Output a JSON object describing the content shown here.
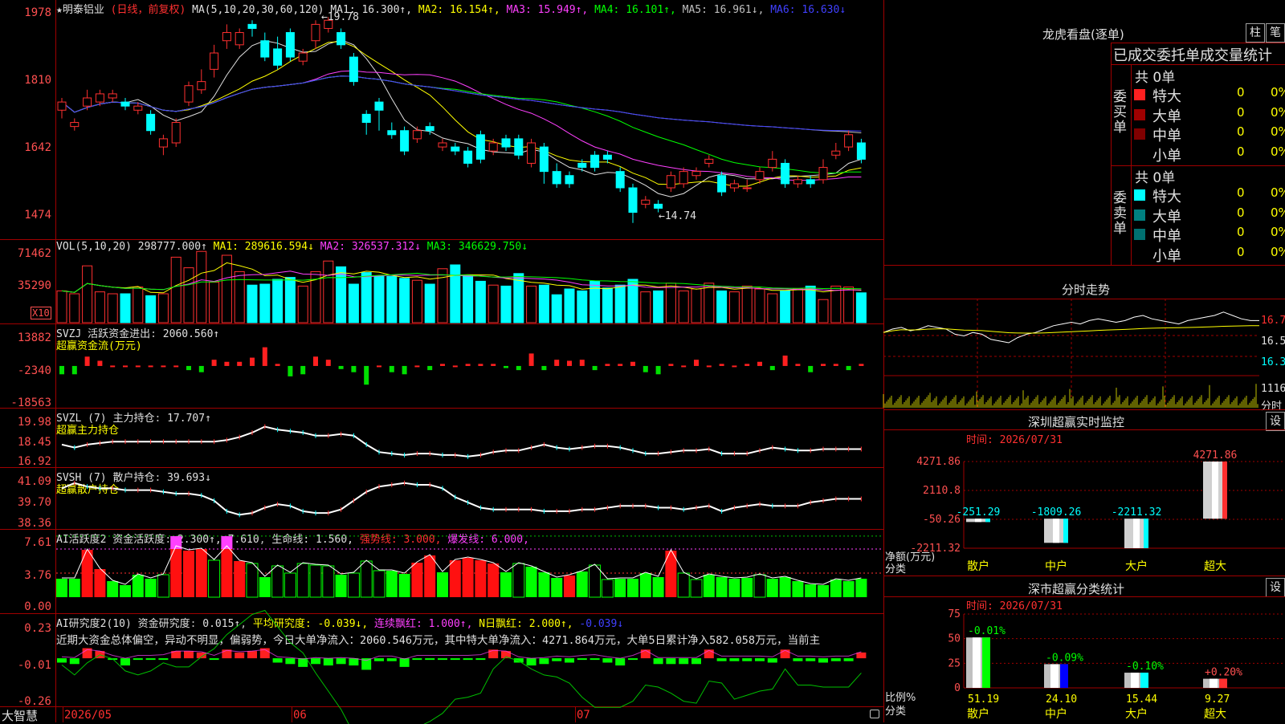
{
  "main_chart": {
    "title": "★明泰铝业",
    "subtitle": "(日线，前复权)",
    "ma_label": "MA(5,10,20,30,60,120)",
    "ma_values": [
      {
        "text": "MA1: 16.300↑,",
        "color": "#e0e0e0"
      },
      {
        "text": "MA2: 16.154↑,",
        "color": "#ffff00"
      },
      {
        "text": "MA3: 15.949↑,",
        "color": "#ff40ff"
      },
      {
        "text": "MA4: 16.101↑,",
        "color": "#00ff00"
      },
      {
        "text": "MA5: 16.961↓,",
        "color": "#c0c0c0"
      },
      {
        "text": "MA6: 16.630↓",
        "color": "#4040ff"
      }
    ],
    "y_ticks": [
      "1978",
      "1810",
      "1642",
      "1474"
    ],
    "high_mark": "19.78",
    "low_mark": "14.74",
    "x_labels": [
      "2026/05",
      "06",
      "07"
    ]
  },
  "chart_data": [
    {
      "type": "candlestick",
      "name": "K线",
      "y_range": [
        14.5,
        20.0
      ],
      "candles": [
        [
          17.5,
          17.7,
          17.3,
          17.8
        ],
        [
          17.1,
          17.2,
          17.0,
          17.3
        ],
        [
          17.6,
          17.8,
          17.5,
          18.0
        ],
        [
          17.7,
          17.9,
          17.6,
          18.0
        ],
        [
          17.8,
          17.9,
          17.7,
          18.0
        ],
        [
          17.7,
          17.6,
          17.5,
          17.8
        ],
        [
          17.5,
          17.6,
          17.4,
          17.7
        ],
        [
          17.4,
          17.0,
          16.9,
          17.5
        ],
        [
          16.6,
          16.8,
          16.4,
          16.9
        ],
        [
          16.7,
          17.2,
          16.6,
          17.3
        ],
        [
          17.7,
          18.1,
          17.6,
          18.2
        ],
        [
          18.0,
          18.2,
          17.9,
          18.5
        ],
        [
          18.5,
          18.9,
          18.3,
          19.1
        ],
        [
          19.2,
          19.4,
          19.0,
          19.6
        ],
        [
          19.1,
          19.4,
          19.0,
          19.5
        ],
        [
          19.6,
          19.5,
          19.3,
          19.7
        ],
        [
          19.2,
          18.8,
          18.7,
          19.4
        ],
        [
          19.0,
          18.6,
          18.5,
          19.3
        ],
        [
          19.4,
          18.8,
          18.7,
          19.5
        ],
        [
          18.7,
          18.9,
          18.6,
          19.0
        ],
        [
          19.2,
          19.6,
          19.0,
          19.7
        ],
        [
          19.5,
          19.7,
          19.4,
          19.78
        ],
        [
          19.4,
          19.1,
          19.0,
          19.5
        ],
        [
          18.8,
          18.2,
          18.1,
          18.9
        ],
        [
          17.4,
          17.2,
          16.9,
          17.5
        ],
        [
          17.7,
          17.5,
          17.0,
          17.8
        ],
        [
          17.0,
          16.9,
          16.8,
          17.2
        ],
        [
          17.0,
          16.5,
          16.4,
          17.1
        ],
        [
          16.8,
          17.0,
          16.7,
          17.1
        ],
        [
          17.1,
          17.0,
          16.9,
          17.2
        ],
        [
          16.6,
          16.7,
          16.5,
          16.8
        ],
        [
          16.6,
          16.5,
          16.4,
          16.7
        ],
        [
          16.5,
          16.2,
          16.1,
          16.6
        ],
        [
          16.9,
          16.3,
          16.2,
          17.0
        ],
        [
          16.5,
          16.7,
          16.4,
          16.8
        ],
        [
          16.8,
          16.6,
          16.5,
          16.9
        ],
        [
          16.8,
          16.4,
          16.3,
          16.9
        ],
        [
          16.2,
          16.7,
          16.1,
          16.8
        ],
        [
          16.6,
          16.0,
          15.7,
          16.7
        ],
        [
          16.0,
          15.7,
          15.6,
          16.2
        ],
        [
          15.9,
          15.7,
          15.6,
          16.0
        ],
        [
          16.2,
          16.1,
          16.0,
          16.3
        ],
        [
          16.4,
          16.1,
          16.0,
          16.5
        ],
        [
          16.4,
          16.3,
          16.2,
          16.5
        ],
        [
          16.0,
          15.6,
          15.5,
          16.1
        ],
        [
          15.6,
          15.0,
          14.74,
          15.7
        ],
        [
          15.2,
          15.3,
          15.1,
          15.4
        ],
        [
          15.2,
          15.1,
          15.0,
          15.3
        ],
        [
          15.6,
          15.9,
          15.5,
          16.0
        ],
        [
          15.7,
          16.0,
          15.6,
          16.1
        ],
        [
          15.9,
          16.0,
          15.8,
          16.1
        ],
        [
          16.2,
          16.3,
          16.1,
          16.4
        ],
        [
          15.9,
          15.5,
          15.4,
          16.0
        ],
        [
          15.6,
          15.7,
          15.5,
          15.8
        ],
        [
          15.6,
          15.6,
          15.5,
          15.8
        ],
        [
          15.8,
          16.0,
          15.7,
          16.1
        ],
        [
          16.1,
          16.3,
          16.0,
          16.5
        ],
        [
          16.2,
          15.7,
          15.6,
          16.3
        ],
        [
          15.7,
          15.8,
          15.6,
          15.9
        ],
        [
          15.8,
          15.7,
          15.6,
          15.9
        ],
        [
          15.8,
          16.1,
          15.7,
          16.3
        ],
        [
          16.4,
          16.5,
          16.3,
          16.7
        ],
        [
          16.6,
          16.9,
          16.5,
          17.0
        ],
        [
          16.7,
          16.3,
          16.2,
          16.8
        ]
      ],
      "legend": [
        "MA1",
        "MA2",
        "MA3",
        "MA4",
        "MA5",
        "MA6"
      ]
    },
    {
      "type": "bar",
      "name": "VOL(5,10,20)",
      "y_range": [
        0,
        80000
      ],
      "header": "298777.000↑",
      "ma": [
        "MA1: 289616.594↓",
        "MA2: 326537.312↓",
        "MA3: 346629.750↓"
      ],
      "y_ticks": [
        "71462",
        "35290"
      ],
      "unit": "X10",
      "values": [
        33000,
        30000,
        59000,
        32000,
        30000,
        30000,
        37000,
        28000,
        30000,
        68000,
        57000,
        74000,
        42000,
        70000,
        53000,
        39000,
        40000,
        45000,
        47000,
        38000,
        53000,
        64000,
        58000,
        40000,
        52000,
        48000,
        48000,
        46000,
        44000,
        40000,
        56000,
        60000,
        49000,
        43000,
        39000,
        38000,
        51000,
        38000,
        39000,
        29000,
        35000,
        33000,
        43000,
        36000,
        39000,
        45000,
        32000,
        33000,
        41000,
        33000,
        35000,
        41000,
        33000,
        32000,
        38000,
        35000,
        30000,
        33000,
        35000,
        38000,
        24000,
        38000,
        37000,
        31000
      ]
    },
    {
      "type": "bar",
      "name": "SVZJ 活跃资金进出",
      "subtitle": "超赢资金流(万元)",
      "value": "2060.560↑",
      "y_ticks": [
        "13882",
        "-2340",
        "-18563"
      ],
      "y_range": [
        -18563,
        13882
      ],
      "values": [
        -4000,
        -4000,
        4500,
        2500,
        200,
        200,
        200,
        200,
        200,
        200,
        -2000,
        -3000,
        3000,
        2000,
        2000,
        4000,
        9000,
        1000,
        -5000,
        -4000,
        4500,
        3000,
        -1500,
        -3000,
        -9000,
        200,
        -3000,
        -4000,
        200,
        -2000,
        1000,
        200,
        1000,
        1000,
        1000,
        -1000,
        -2000,
        6000,
        -2000,
        3000,
        2500,
        3000,
        -2000,
        1000,
        1000,
        2000,
        -3000,
        -4000,
        1000,
        200,
        3000,
        200,
        1000,
        200,
        1000,
        2000,
        -2000,
        5000,
        1000,
        -3000,
        1000,
        1000,
        -2000,
        1000
      ]
    },
    {
      "type": "line",
      "name": "SVZL (7) 主力持仓",
      "subtitle": "超赢主力持仓",
      "value": "17.707↑",
      "y_ticks": [
        "19.98",
        "18.45",
        "16.92"
      ],
      "y_range": [
        16.92,
        19.98
      ],
      "values": [
        18.0,
        17.8,
        18.0,
        18.1,
        18.2,
        18.2,
        18.2,
        18.2,
        18.2,
        18.2,
        18.2,
        18.2,
        18.2,
        18.3,
        18.5,
        18.8,
        19.2,
        19.0,
        18.9,
        18.8,
        18.6,
        18.6,
        18.7,
        18.6,
        18.0,
        17.5,
        17.4,
        17.3,
        17.4,
        17.4,
        17.3,
        17.3,
        17.2,
        17.3,
        17.5,
        17.6,
        17.6,
        17.8,
        18.0,
        17.8,
        17.7,
        17.8,
        17.9,
        17.9,
        17.8,
        17.6,
        17.4,
        17.4,
        17.5,
        17.6,
        17.6,
        17.7,
        17.4,
        17.4,
        17.4,
        17.6,
        17.8,
        17.7,
        17.6,
        17.6,
        17.7,
        17.7,
        17.7,
        17.7
      ]
    },
    {
      "type": "line",
      "name": "SVSH (7) 散户持仓",
      "subtitle": "超赢散户持仓",
      "value": "39.693↓",
      "y_ticks": [
        "41.09",
        "39.70",
        "38.36"
      ],
      "y_range": [
        38.36,
        41.09
      ],
      "values": [
        40.3,
        40.6,
        40.4,
        40.3,
        40.3,
        40.2,
        40.2,
        40.2,
        40.1,
        40.0,
        40.0,
        39.9,
        39.6,
        39.0,
        38.8,
        38.9,
        39.2,
        39.4,
        39.3,
        39.0,
        38.9,
        38.9,
        39.1,
        39.6,
        40.1,
        40.4,
        40.5,
        40.6,
        40.5,
        40.5,
        40.3,
        39.8,
        39.5,
        39.2,
        39.1,
        39.1,
        39.1,
        39.1,
        39.0,
        39.0,
        39.0,
        39.1,
        39.1,
        39.2,
        39.3,
        39.3,
        39.3,
        39.2,
        39.2,
        39.1,
        39.2,
        39.3,
        39.0,
        39.2,
        39.3,
        39.4,
        39.3,
        39.3,
        39.3,
        39.5,
        39.6,
        39.7,
        39.7,
        39.7
      ]
    },
    {
      "type": "bar",
      "name": "AI活跃度2 资金活跃度",
      "value": "2.300↑, 7.610",
      "extras": [
        {
          "text": "生命线: 1.560,",
          "color": "#e0e0e0"
        },
        {
          "text": "强势线: 3.000,",
          "color": "#ff3030"
        },
        {
          "text": "爆发线: 6.000,",
          "color": "#ff40ff"
        }
      ],
      "y_ticks": [
        "7.61",
        "3.76",
        "0.00"
      ],
      "y_range": [
        0,
        8
      ],
      "values": [
        2.3,
        2.3,
        5.9,
        3.5,
        2.0,
        1.5,
        2.8,
        2.3,
        2.8,
        6.3,
        5.8,
        6.0,
        4.6,
        6.3,
        4.5,
        4.2,
        2.5,
        3.9,
        3.0,
        4.2,
        4.0,
        3.9,
        2.8,
        3.0,
        4.5,
        3.3,
        3.3,
        2.9,
        4.3,
        5.2,
        3.1,
        4.6,
        4.9,
        4.6,
        4.2,
        3.1,
        4.2,
        3.8,
        3.1,
        2.4,
        2.7,
        3.2,
        4.0,
        2.2,
        2.3,
        2.3,
        3.0,
        2.5,
        5.8,
        3.0,
        2.2,
        2.8,
        2.5,
        2.3,
        2.4,
        2.8,
        2.3,
        2.5,
        2.0,
        1.6,
        1.5,
        2.2,
        2.0,
        2.3
      ],
      "types": [
        "g",
        "g",
        "r",
        "r",
        "g",
        "g",
        "g",
        "g",
        "o",
        "r",
        "r",
        "r",
        "o",
        "r",
        "r",
        "o",
        "g",
        "o",
        "o",
        "o",
        "o",
        "o",
        "g",
        "o",
        "o",
        "o",
        "g",
        "g",
        "r",
        "r",
        "g",
        "r",
        "r",
        "r",
        "r",
        "g",
        "o",
        "g",
        "g",
        "g",
        "r",
        "g",
        "o",
        "o",
        "g",
        "g",
        "g",
        "g",
        "r",
        "o",
        "o",
        "g",
        "g",
        "g",
        "g",
        "o",
        "g",
        "g",
        "g",
        "g",
        "g",
        "g",
        "g",
        "g"
      ]
    },
    {
      "type": "bar",
      "name": "AI研究度2(10) 资金研究度",
      "value": "0.015↑",
      "extras": [
        {
          "text": "平均研究度: -0.039↓,",
          "color": "#ffff00"
        },
        {
          "text": "连续飘红: 1.000↑,",
          "color": "#ff40ff"
        },
        {
          "text": "N日飘红: 2.000↑,",
          "color": "#ffff00"
        },
        {
          "text": "-0.039↓",
          "color": "#4040ff"
        }
      ],
      "comment": "近期大资金总体偏空，异动不明显，偏弱势，今日大单净流入：2060.546万元，其中特大单净流入：4271.864万元，大单5日累计净入582.058万元，当前主",
      "y_ticks": [
        "0.23",
        "-0.01",
        "-0.26"
      ],
      "y_range": [
        -0.26,
        0.23
      ],
      "values": [
        -0.04,
        -0.05,
        0.06,
        0.04,
        -0.02,
        -0.06,
        -0.02,
        -0.02,
        -0.01,
        0.04,
        0.04,
        0.03,
        -0.02,
        0.05,
        0.03,
        0.04,
        0.06,
        -0.04,
        -0.05,
        -0.07,
        -0.05,
        -0.06,
        -0.05,
        -0.06,
        -0.09,
        -0.03,
        -0.03,
        -0.07,
        -0.02,
        -0.02,
        -0.02,
        -0.02,
        -0.02,
        -0.01,
        0.05,
        0.04,
        -0.04,
        -0.06,
        -0.05,
        -0.03,
        -0.04,
        -0.02,
        -0.01,
        -0.04,
        -0.06,
        -0.02,
        0.05,
        -0.05,
        -0.05,
        -0.05,
        -0.05,
        0.05,
        -0.03,
        -0.03,
        -0.03,
        -0.03,
        -0.04,
        0.05,
        -0.03,
        -0.03,
        -0.04,
        -0.03,
        -0.03,
        0.03
      ]
    },
    {
      "type": "line",
      "name": "分时走势",
      "y_ticks": [
        "16.77",
        "16.56",
        "16.34"
      ],
      "vol_label": "11167",
      "time_label": "分时",
      "values": [
        16.62,
        16.66,
        16.68,
        16.64,
        16.66,
        16.7,
        16.68,
        16.66,
        16.6,
        16.58,
        16.62,
        16.6,
        16.54,
        16.52,
        16.5,
        16.56,
        16.6,
        16.62,
        16.66,
        16.7,
        16.72,
        16.74,
        16.72,
        16.76,
        16.78,
        16.76,
        16.74,
        16.76,
        16.8,
        16.82,
        16.78,
        16.76,
        16.74,
        16.72,
        16.76,
        16.78,
        16.8,
        16.82,
        16.86,
        16.82,
        16.78,
        16.76,
        16.76
      ]
    },
    {
      "type": "bar",
      "name": "深圳超赢实时监控",
      "date": "时间: 2026/07/31",
      "y_ticks": [
        "4271.86",
        "2110.8",
        "-50.26",
        "-2211.32"
      ],
      "y_label": "净额(万元)",
      "x_title": "分类",
      "categories": [
        "散户",
        "中户",
        "大户",
        "超大"
      ],
      "values": [
        -251.29,
        -1809.26,
        -2211.32,
        4271.86
      ],
      "y_range": [
        -2211.32,
        4271.86
      ]
    },
    {
      "type": "bar",
      "name": "深市超赢分类统计",
      "date": "时间: 2026/07/31",
      "y_ticks": [
        "75",
        "50",
        "25",
        "0"
      ],
      "y_label": "比例%",
      "x_title": "分类",
      "categories": [
        "散户",
        "中户",
        "大户",
        "超大"
      ],
      "values": [
        51.19,
        24.1,
        15.44,
        9.27
      ],
      "changes": [
        "-0.01%",
        "-0.09%",
        "-0.10%",
        "+0.20%"
      ],
      "y_range": [
        0,
        75
      ]
    }
  ],
  "right_panel": {
    "lhb_title": "龙虎看盘(逐单)",
    "btn_zhu": "柱",
    "btn_bi": "笔",
    "order_header": "已成交委托单成交量统计",
    "buy_label": "委买单",
    "sell_label": "委卖单",
    "buy_total": "共 0单",
    "sell_total": "共 0单",
    "buy_rows": [
      {
        "label": "特大",
        "count": "0",
        "pct": "0%",
        "color": "#ff2020"
      },
      {
        "label": "大单",
        "count": "0",
        "pct": "0%",
        "color": "#a00000"
      },
      {
        "label": "中单",
        "count": "0",
        "pct": "0%",
        "color": "#800000"
      },
      {
        "label": "小单",
        "count": "0",
        "pct": "0%",
        "color": "#000000"
      }
    ],
    "sell_rows": [
      {
        "label": "特大",
        "count": "0",
        "pct": "0%",
        "color": "#00ffff"
      },
      {
        "label": "大单",
        "count": "0",
        "pct": "0%",
        "color": "#008080"
      },
      {
        "label": "中单",
        "count": "0",
        "pct": "0%",
        "color": "#007070"
      },
      {
        "label": "小单",
        "count": "0",
        "pct": "0%",
        "color": "#000000"
      }
    ],
    "set_label": "设"
  },
  "footer": {
    "brand": "大智慧"
  }
}
